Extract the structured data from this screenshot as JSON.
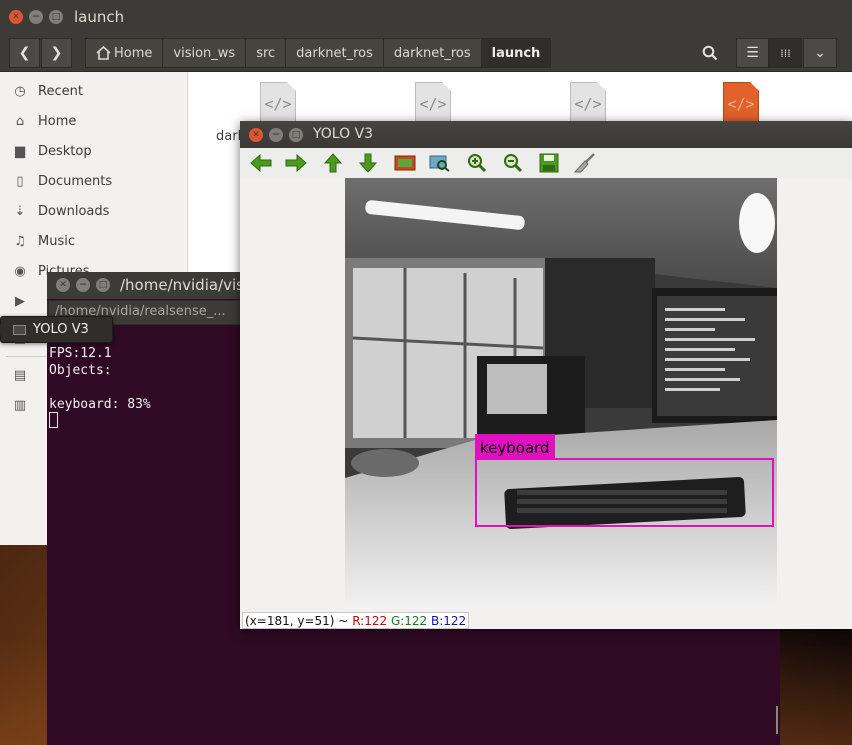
{
  "file_manager": {
    "window_title": "launch",
    "breadcrumbs": [
      {
        "label": "Home"
      },
      {
        "label": "vision_ws"
      },
      {
        "label": "src"
      },
      {
        "label": "darknet_ros"
      },
      {
        "label": "darknet_ros"
      },
      {
        "label": "launch"
      }
    ],
    "sidebar": [
      {
        "label": "Recent",
        "icon": "clock-icon"
      },
      {
        "label": "Home",
        "icon": "home-icon"
      },
      {
        "label": "Desktop",
        "icon": "folder-icon"
      },
      {
        "label": "Documents",
        "icon": "document-icon"
      },
      {
        "label": "Downloads",
        "icon": "download-icon"
      },
      {
        "label": "Music",
        "icon": "music-icon"
      },
      {
        "label": "Pictures",
        "icon": "camera-icon"
      }
    ],
    "partial_file_label": "dark"
  },
  "terminal": {
    "window_title": "/home/nvidia/vis",
    "tab_label": "/home/nvidia/realsense_...",
    "output": "FPS:12.1\nObjects:\n\nkeyboard: 83%"
  },
  "tooltip": {
    "label": "YOLO V3"
  },
  "yolo_window": {
    "title": "YOLO V3",
    "toolbar": [
      "arrow-left-icon",
      "arrow-right-icon",
      "arrow-up-icon",
      "arrow-down-icon",
      "image-icon",
      "zoom-region-icon",
      "zoom-in-icon",
      "zoom-out-icon",
      "save-icon",
      "brush-icon"
    ],
    "detection": {
      "label": "keyboard",
      "color": "#e010c0"
    },
    "status": {
      "coords": "(x=181, y=51) ~",
      "r": "R:122",
      "g": "G:122",
      "b": "B:122",
      "r_color": "#d00000",
      "g_color": "#108010",
      "b_color": "#1010c0"
    }
  }
}
